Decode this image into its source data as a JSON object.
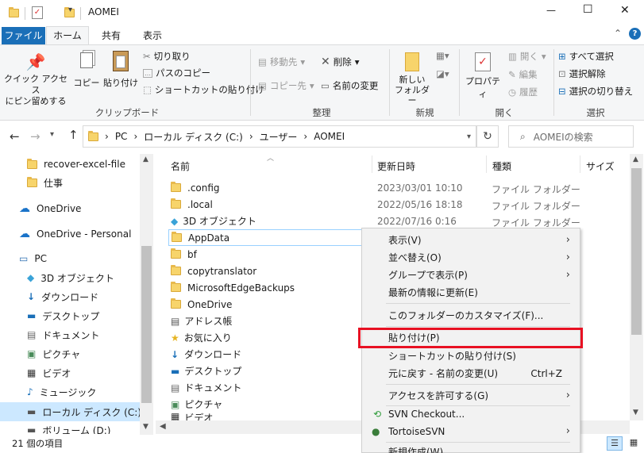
{
  "window": {
    "title": "AOMEI",
    "minimize": "—",
    "maximize": "☐",
    "close": "✕"
  },
  "ribbon_tabs": [
    "ファイル",
    "ホーム",
    "共有",
    "表示"
  ],
  "ribbon": {
    "pin": "クイック アクセス\nにピン留めする",
    "copy": "コピー",
    "paste": "貼り付け",
    "cut": "切り取り",
    "copy_path": "パスのコピー",
    "paste_shortcut": "ショートカットの貼り付け",
    "clipboard_group": "クリップボード",
    "move_to": "移動先",
    "delete": "削除",
    "copy_to": "コピー先",
    "rename": "名前の変更",
    "organize_group": "整理",
    "new_folder": "新しい\nフォルダー",
    "new_group": "新規",
    "properties": "プロパティ",
    "open": "開く",
    "edit": "編集",
    "history": "履歴",
    "open_group": "開く",
    "select_all": "すべて選択",
    "select_none": "選択解除",
    "invert_selection": "選択の切り替え",
    "select_group": "選択"
  },
  "address": {
    "parts": [
      "PC",
      "ローカル ディスク (C:)",
      "ユーザー",
      "AOMEI"
    ],
    "search_placeholder": "AOMEIの検索"
  },
  "nav_items": [
    {
      "label": "recover-excel-file",
      "icon": "folder-icon"
    },
    {
      "label": "仕事",
      "icon": "folder-icon"
    },
    {
      "label": "OneDrive",
      "icon": "cloud-icon"
    },
    {
      "label": "OneDrive - Personal",
      "icon": "cloud-icon"
    },
    {
      "label": "PC",
      "icon": "pc-icon"
    },
    {
      "label": "3D オブジェクト",
      "icon": "cube-icon"
    },
    {
      "label": "ダウンロード",
      "icon": "download-icon"
    },
    {
      "label": "デスクトップ",
      "icon": "desktop-icon"
    },
    {
      "label": "ドキュメント",
      "icon": "document-icon"
    },
    {
      "label": "ピクチャ",
      "icon": "picture-icon"
    },
    {
      "label": "ビデオ",
      "icon": "video-icon"
    },
    {
      "label": "ミュージック",
      "icon": "music-icon"
    },
    {
      "label": "ローカル ディスク (C:)",
      "icon": "drive-icon"
    },
    {
      "label": "ボリューム (D:)",
      "icon": "drive-icon"
    }
  ],
  "columns": [
    "名前",
    "更新日時",
    "種類",
    "サイズ"
  ],
  "files": [
    {
      "name": ".config",
      "date": "2023/03/01 10:10",
      "type": "ファイル フォルダー"
    },
    {
      "name": ".local",
      "date": "2022/05/16 18:18",
      "type": "ファイル フォルダー"
    },
    {
      "name": "3D オブジェクト",
      "date": "2022/07/16 0:16",
      "type": "ファイル フォルダー"
    },
    {
      "name": "AppData",
      "date": "",
      "type": ""
    },
    {
      "name": "bf",
      "date": "",
      "type": ""
    },
    {
      "name": "copytranslator",
      "date": "",
      "type": ""
    },
    {
      "name": "MicrosoftEdgeBackups",
      "date": "",
      "type": ""
    },
    {
      "name": "OneDrive",
      "date": "",
      "type": ""
    },
    {
      "name": "アドレス帳",
      "date": "",
      "type": ""
    },
    {
      "name": "お気に入り",
      "date": "",
      "type": ""
    },
    {
      "name": "ダウンロード",
      "date": "",
      "type": ""
    },
    {
      "name": "デスクトップ",
      "date": "",
      "type": ""
    },
    {
      "name": "ドキュメント",
      "date": "",
      "type": ""
    },
    {
      "name": "ピクチャ",
      "date": "",
      "type": ""
    },
    {
      "name": "ビデオ",
      "date": "",
      "type": ""
    }
  ],
  "context_menu": [
    {
      "label": "表示(V)",
      "shortcut": "",
      "arrow": "›"
    },
    {
      "label": "並べ替え(O)",
      "shortcut": "",
      "arrow": "›"
    },
    {
      "label": "グループで表示(P)",
      "shortcut": "",
      "arrow": "›"
    },
    {
      "label": "最新の情報に更新(E)",
      "shortcut": "",
      "arrow": ""
    },
    {
      "label": "このフォルダーのカスタマイズ(F)...",
      "shortcut": "",
      "arrow": ""
    },
    {
      "label": "貼り付け(P)",
      "shortcut": "",
      "arrow": ""
    },
    {
      "label": "ショートカットの貼り付け(S)",
      "shortcut": "",
      "arrow": ""
    },
    {
      "label": "元に戻す - 名前の変更(U)",
      "shortcut": "Ctrl+Z",
      "arrow": ""
    },
    {
      "label": "アクセスを許可する(G)",
      "shortcut": "",
      "arrow": "›"
    },
    {
      "label": "SVN Checkout...",
      "shortcut": "",
      "arrow": ""
    },
    {
      "label": "TortoiseSVN",
      "shortcut": "",
      "arrow": "›"
    },
    {
      "label": "新規作成(W)",
      "shortcut": "",
      "arrow": ""
    }
  ],
  "status": {
    "count": "21 個の項目"
  },
  "highlight_color": "#e81123"
}
